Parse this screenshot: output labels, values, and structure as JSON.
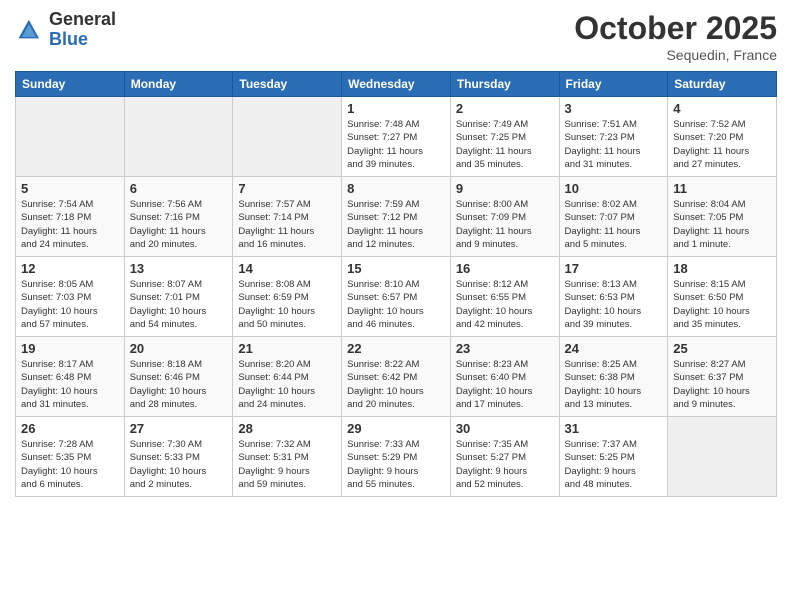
{
  "header": {
    "logo_general": "General",
    "logo_blue": "Blue",
    "month": "October 2025",
    "location": "Sequedin, France"
  },
  "days_of_week": [
    "Sunday",
    "Monday",
    "Tuesday",
    "Wednesday",
    "Thursday",
    "Friday",
    "Saturday"
  ],
  "weeks": [
    [
      {
        "day": "",
        "info": ""
      },
      {
        "day": "",
        "info": ""
      },
      {
        "day": "",
        "info": ""
      },
      {
        "day": "1",
        "info": "Sunrise: 7:48 AM\nSunset: 7:27 PM\nDaylight: 11 hours\nand 39 minutes."
      },
      {
        "day": "2",
        "info": "Sunrise: 7:49 AM\nSunset: 7:25 PM\nDaylight: 11 hours\nand 35 minutes."
      },
      {
        "day": "3",
        "info": "Sunrise: 7:51 AM\nSunset: 7:23 PM\nDaylight: 11 hours\nand 31 minutes."
      },
      {
        "day": "4",
        "info": "Sunrise: 7:52 AM\nSunset: 7:20 PM\nDaylight: 11 hours\nand 27 minutes."
      }
    ],
    [
      {
        "day": "5",
        "info": "Sunrise: 7:54 AM\nSunset: 7:18 PM\nDaylight: 11 hours\nand 24 minutes."
      },
      {
        "day": "6",
        "info": "Sunrise: 7:56 AM\nSunset: 7:16 PM\nDaylight: 11 hours\nand 20 minutes."
      },
      {
        "day": "7",
        "info": "Sunrise: 7:57 AM\nSunset: 7:14 PM\nDaylight: 11 hours\nand 16 minutes."
      },
      {
        "day": "8",
        "info": "Sunrise: 7:59 AM\nSunset: 7:12 PM\nDaylight: 11 hours\nand 12 minutes."
      },
      {
        "day": "9",
        "info": "Sunrise: 8:00 AM\nSunset: 7:09 PM\nDaylight: 11 hours\nand 9 minutes."
      },
      {
        "day": "10",
        "info": "Sunrise: 8:02 AM\nSunset: 7:07 PM\nDaylight: 11 hours\nand 5 minutes."
      },
      {
        "day": "11",
        "info": "Sunrise: 8:04 AM\nSunset: 7:05 PM\nDaylight: 11 hours\nand 1 minute."
      }
    ],
    [
      {
        "day": "12",
        "info": "Sunrise: 8:05 AM\nSunset: 7:03 PM\nDaylight: 10 hours\nand 57 minutes."
      },
      {
        "day": "13",
        "info": "Sunrise: 8:07 AM\nSunset: 7:01 PM\nDaylight: 10 hours\nand 54 minutes."
      },
      {
        "day": "14",
        "info": "Sunrise: 8:08 AM\nSunset: 6:59 PM\nDaylight: 10 hours\nand 50 minutes."
      },
      {
        "day": "15",
        "info": "Sunrise: 8:10 AM\nSunset: 6:57 PM\nDaylight: 10 hours\nand 46 minutes."
      },
      {
        "day": "16",
        "info": "Sunrise: 8:12 AM\nSunset: 6:55 PM\nDaylight: 10 hours\nand 42 minutes."
      },
      {
        "day": "17",
        "info": "Sunrise: 8:13 AM\nSunset: 6:53 PM\nDaylight: 10 hours\nand 39 minutes."
      },
      {
        "day": "18",
        "info": "Sunrise: 8:15 AM\nSunset: 6:50 PM\nDaylight: 10 hours\nand 35 minutes."
      }
    ],
    [
      {
        "day": "19",
        "info": "Sunrise: 8:17 AM\nSunset: 6:48 PM\nDaylight: 10 hours\nand 31 minutes."
      },
      {
        "day": "20",
        "info": "Sunrise: 8:18 AM\nSunset: 6:46 PM\nDaylight: 10 hours\nand 28 minutes."
      },
      {
        "day": "21",
        "info": "Sunrise: 8:20 AM\nSunset: 6:44 PM\nDaylight: 10 hours\nand 24 minutes."
      },
      {
        "day": "22",
        "info": "Sunrise: 8:22 AM\nSunset: 6:42 PM\nDaylight: 10 hours\nand 20 minutes."
      },
      {
        "day": "23",
        "info": "Sunrise: 8:23 AM\nSunset: 6:40 PM\nDaylight: 10 hours\nand 17 minutes."
      },
      {
        "day": "24",
        "info": "Sunrise: 8:25 AM\nSunset: 6:38 PM\nDaylight: 10 hours\nand 13 minutes."
      },
      {
        "day": "25",
        "info": "Sunrise: 8:27 AM\nSunset: 6:37 PM\nDaylight: 10 hours\nand 9 minutes."
      }
    ],
    [
      {
        "day": "26",
        "info": "Sunrise: 7:28 AM\nSunset: 5:35 PM\nDaylight: 10 hours\nand 6 minutes."
      },
      {
        "day": "27",
        "info": "Sunrise: 7:30 AM\nSunset: 5:33 PM\nDaylight: 10 hours\nand 2 minutes."
      },
      {
        "day": "28",
        "info": "Sunrise: 7:32 AM\nSunset: 5:31 PM\nDaylight: 9 hours\nand 59 minutes."
      },
      {
        "day": "29",
        "info": "Sunrise: 7:33 AM\nSunset: 5:29 PM\nDaylight: 9 hours\nand 55 minutes."
      },
      {
        "day": "30",
        "info": "Sunrise: 7:35 AM\nSunset: 5:27 PM\nDaylight: 9 hours\nand 52 minutes."
      },
      {
        "day": "31",
        "info": "Sunrise: 7:37 AM\nSunset: 5:25 PM\nDaylight: 9 hours\nand 48 minutes."
      },
      {
        "day": "",
        "info": ""
      }
    ]
  ]
}
